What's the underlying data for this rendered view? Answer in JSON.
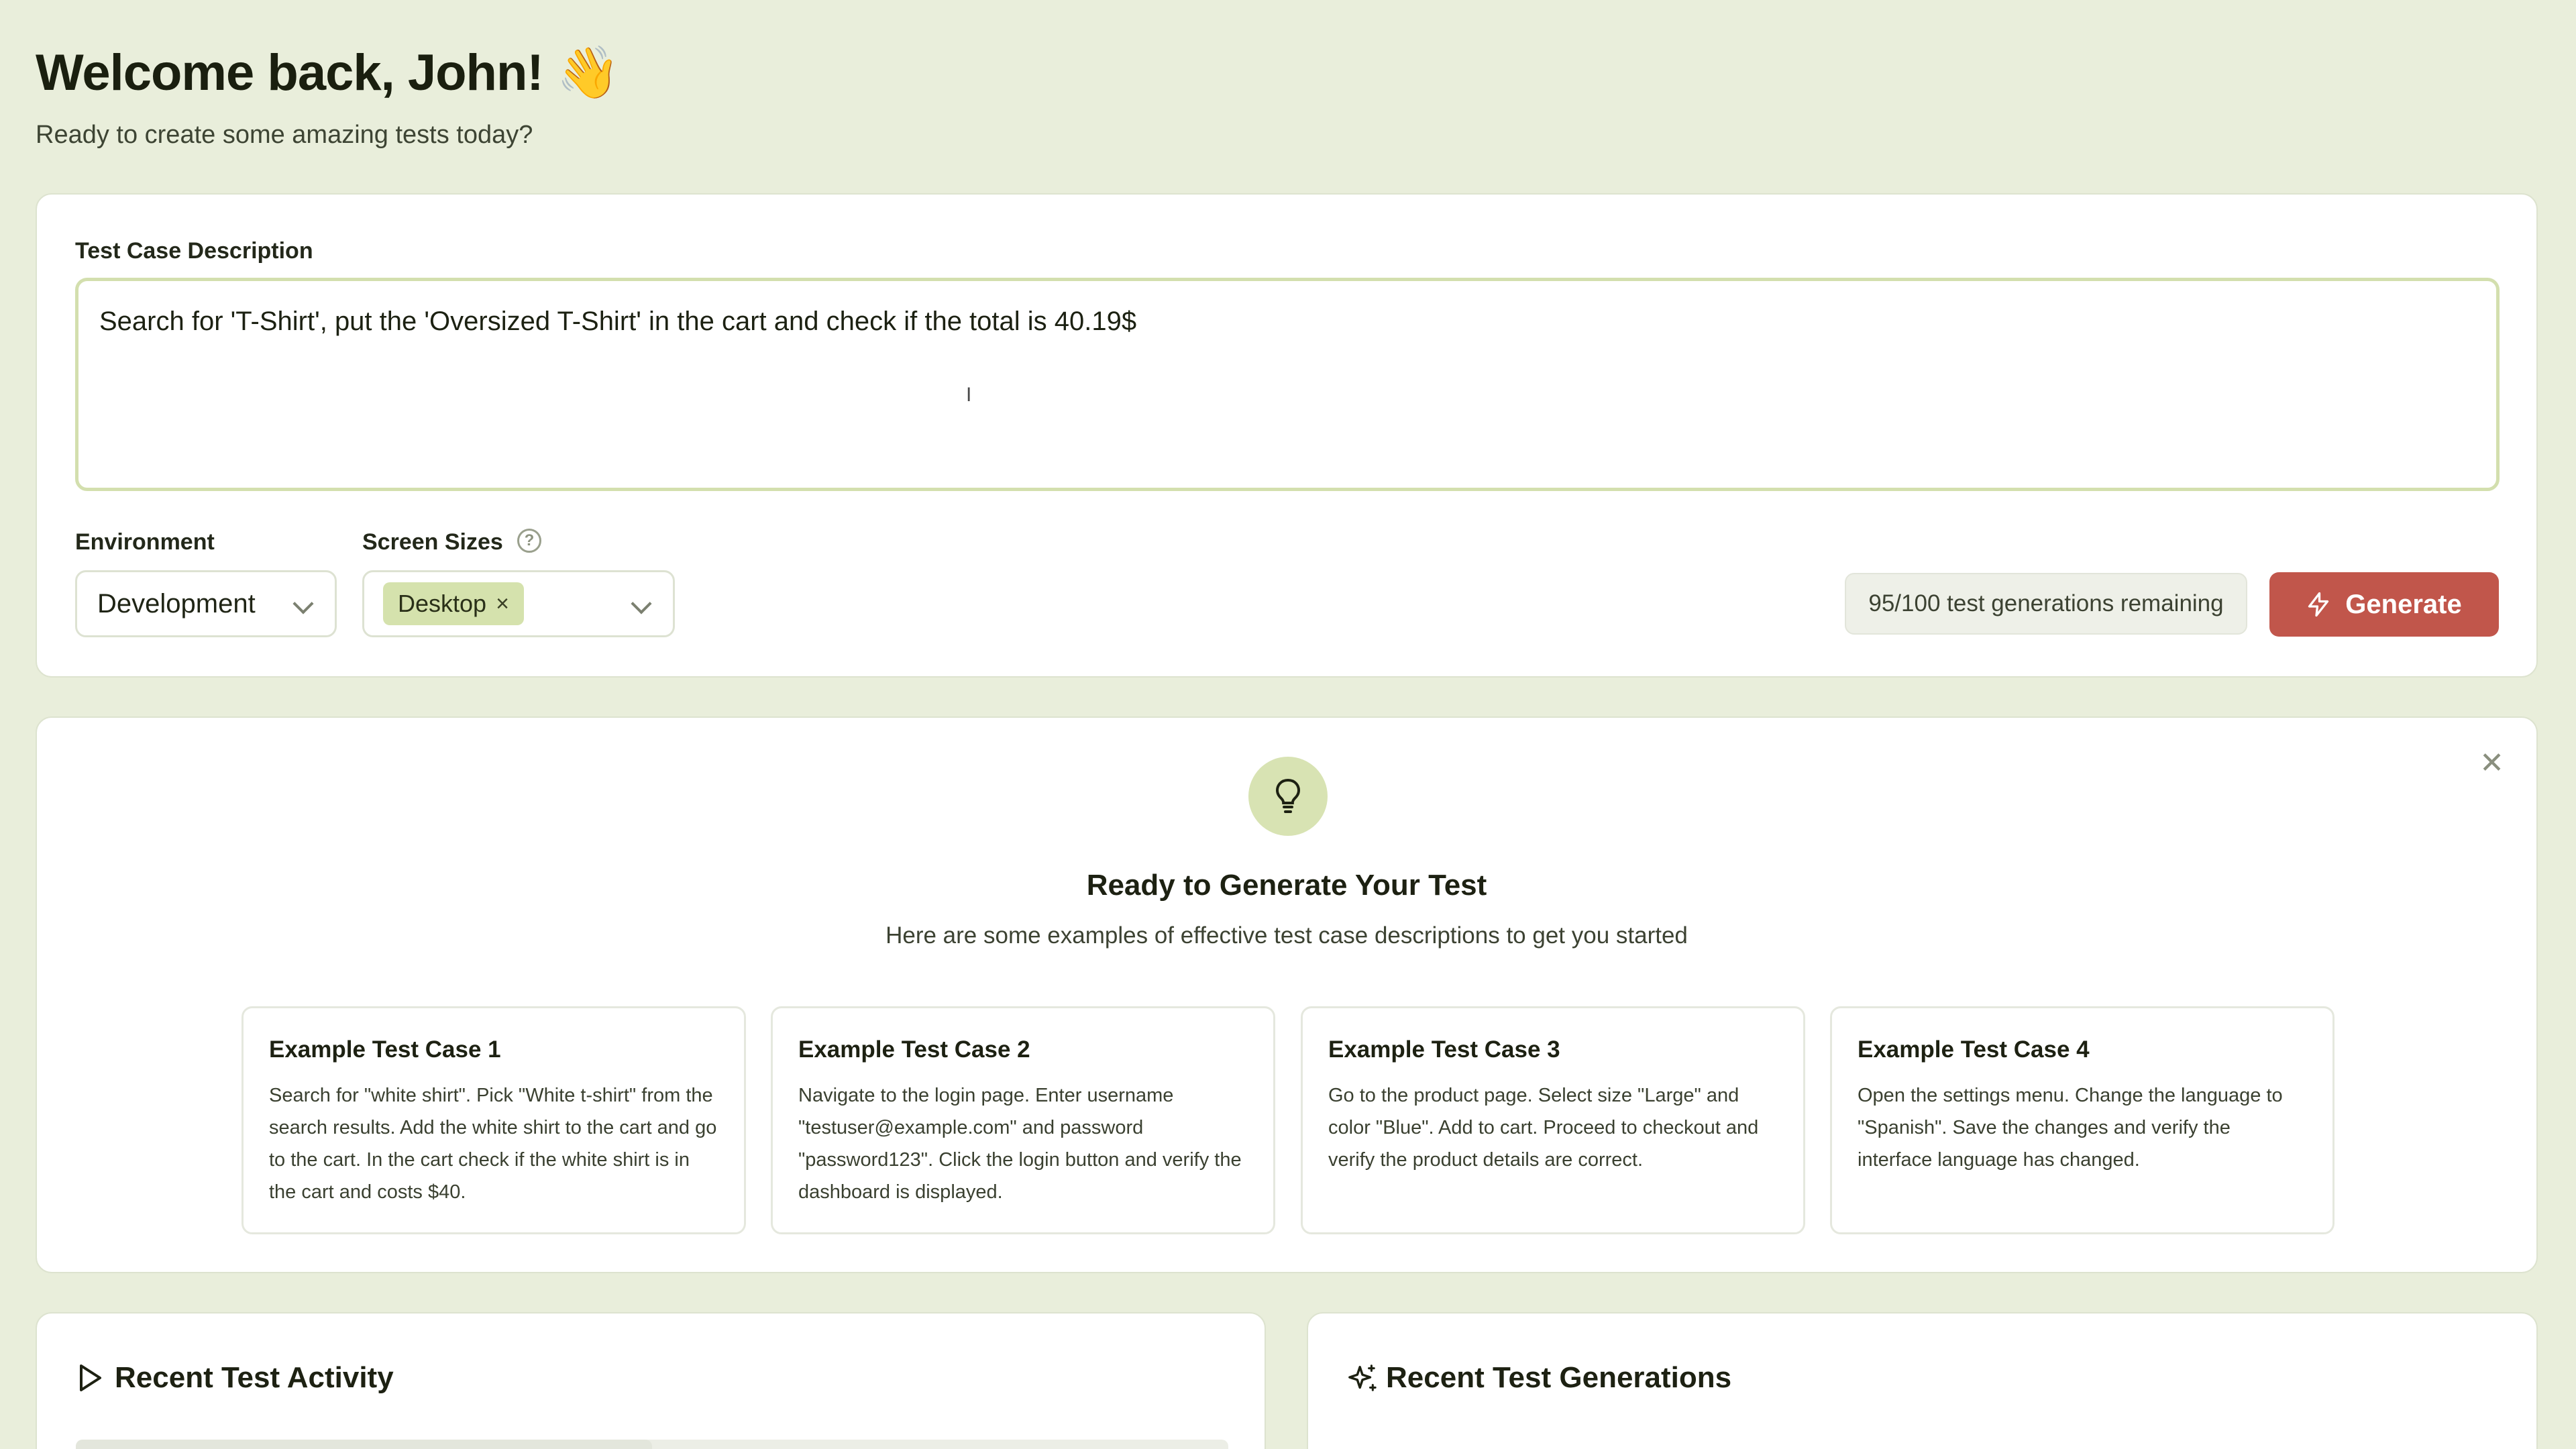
{
  "header": {
    "title": "Welcome back, John! 👋",
    "subtitle": "Ready to create some amazing tests today?"
  },
  "form": {
    "description_label": "Test Case Description",
    "description_value": "Search for 'T-Shirt', put the 'Oversized T-Shirt' in the cart and check if the total is 40.19$",
    "environment_label": "Environment",
    "environment_value": "Development",
    "screen_sizes_label": "Screen Sizes",
    "screen_size_chip": "Desktop",
    "remaining": "95/100 test generations remaining",
    "generate_label": "Generate"
  },
  "tips": {
    "title": "Ready to Generate Your Test",
    "subtitle": "Here are some examples of effective test case descriptions to get you started",
    "examples": [
      {
        "title": "Example Test Case 1",
        "text": "Search for \"white shirt\". Pick \"White t-shirt\" from the search results. Add the white shirt to the cart and go to the cart. In the cart check if the white shirt is in the cart and costs $40."
      },
      {
        "title": "Example Test Case 2",
        "text": "Navigate to the login page. Enter username \"testuser@example.com\" and password \"password123\". Click the login button and verify the dashboard is displayed."
      },
      {
        "title": "Example Test Case 3",
        "text": "Go to the product page. Select size \"Large\" and color \"Blue\". Add to cart. Proceed to checkout and verify the product details are correct."
      },
      {
        "title": "Example Test Case 4",
        "text": "Open the settings menu. Change the language to \"Spanish\". Save the changes and verify the interface language has changed."
      }
    ]
  },
  "recent_activity": {
    "title": "Recent Test Activity"
  },
  "recent_generations": {
    "title": "Recent Test Generations"
  },
  "colors": {
    "background": "#e9eedb",
    "accent_button": "#c1564b",
    "chip": "#d5e2ad",
    "textarea_border": "#d3dfae"
  },
  "icons": {
    "help": "question-circle-icon",
    "generate": "lightning-icon",
    "tips": "lightbulb-icon",
    "close": "close-icon",
    "activity": "play-icon",
    "generations": "sparkles-icon"
  }
}
